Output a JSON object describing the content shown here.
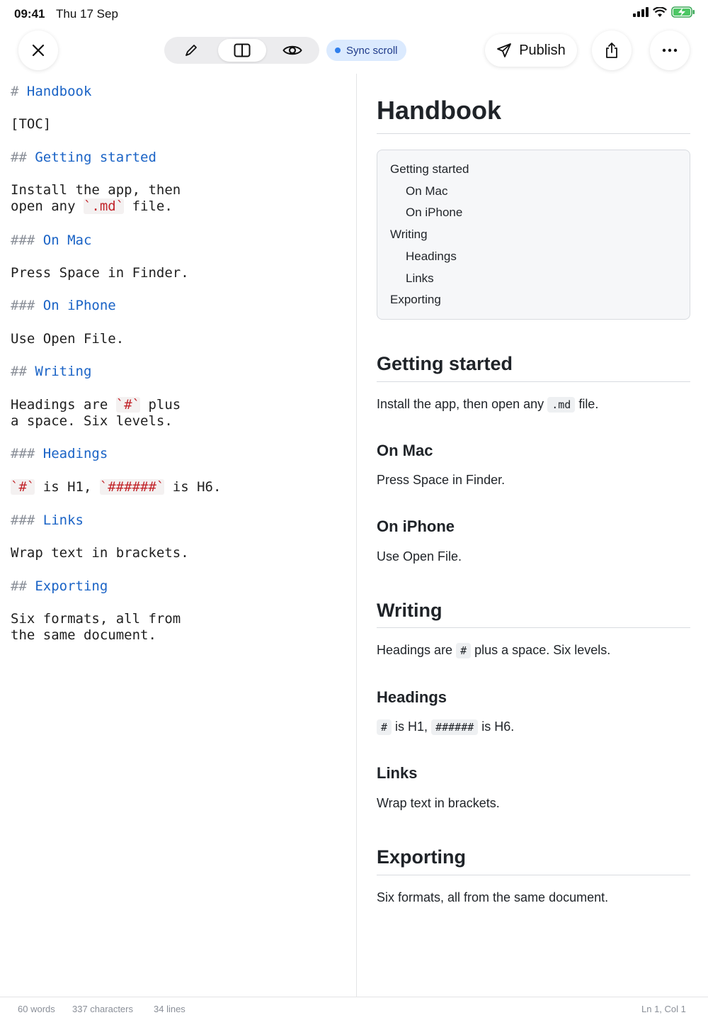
{
  "status_bar": {
    "time": "09:41",
    "date": "Thu 17 Sep"
  },
  "toolbar": {
    "close_icon": "close-icon",
    "modes": [
      "edit-pencil-icon",
      "split-view-icon",
      "preview-eye-icon"
    ],
    "active_mode": "split-view",
    "sync_label": "Sync scroll",
    "publish_label": "Publish",
    "share_icon": "share-icon",
    "more_icon": "more-icon"
  },
  "editor": {
    "lines": {
      "h1": {
        "mark": "#",
        "text": "Handbook"
      },
      "toc": "[TOC]",
      "h2_getting": {
        "mark": "##",
        "text": "Getting started"
      },
      "p_install_1": "Install the app, then",
      "p_install_2a": "open any ",
      "p_install_code": "`.md`",
      "p_install_2b": " file.",
      "h3_mac": {
        "mark": "###",
        "text": "On Mac"
      },
      "p_mac": "Press Space in Finder.",
      "h3_iphone": {
        "mark": "###",
        "text": "On iPhone"
      },
      "p_iphone": "Use Open File.",
      "h2_writing": {
        "mark": "##",
        "text": "Writing"
      },
      "p_writing_1a": "Headings are ",
      "p_writing_code": "`#`",
      "p_writing_1b": " plus",
      "p_writing_2": "a space. Six levels.",
      "h3_headings": {
        "mark": "###",
        "text": "Headings"
      },
      "p_headings_code1": "`#`",
      "p_headings_mid": " is H1, ",
      "p_headings_code2": "`######`",
      "p_headings_end": " is H6.",
      "h3_links": {
        "mark": "###",
        "text": "Links"
      },
      "p_links": "Wrap text in brackets.",
      "h2_exporting": {
        "mark": "##",
        "text": "Exporting"
      },
      "p_export_1": "Six formats, all from",
      "p_export_2": "the same document."
    }
  },
  "preview": {
    "title": "Handbook",
    "toc": [
      "Getting started",
      "On Mac",
      "On iPhone",
      "Writing",
      "Headings",
      "Links",
      "Exporting"
    ],
    "getting_started": {
      "heading": "Getting started",
      "text_a": "Install the app, then open any",
      "code": ".md",
      "text_b": "file."
    },
    "on_mac": {
      "heading": "On Mac",
      "text": "Press Space in Finder."
    },
    "on_iphone": {
      "heading": "On iPhone",
      "text": "Use Open File."
    },
    "writing": {
      "heading": "Writing",
      "text_a": "Headings are",
      "code": "#",
      "text_b": "plus a space. Six levels."
    },
    "headings": {
      "heading": "Headings",
      "code1": "#",
      "text_a": "is H1,",
      "code2": "######",
      "text_b": "is H6."
    },
    "links": {
      "heading": "Links",
      "text": "Wrap text in brackets."
    },
    "exporting": {
      "heading": "Exporting",
      "text": "Six formats, all from the same document."
    }
  },
  "footer": {
    "words": "60 words",
    "characters": "337 characters",
    "lines": "34 lines",
    "cursor": "Ln 1, Col 1"
  }
}
